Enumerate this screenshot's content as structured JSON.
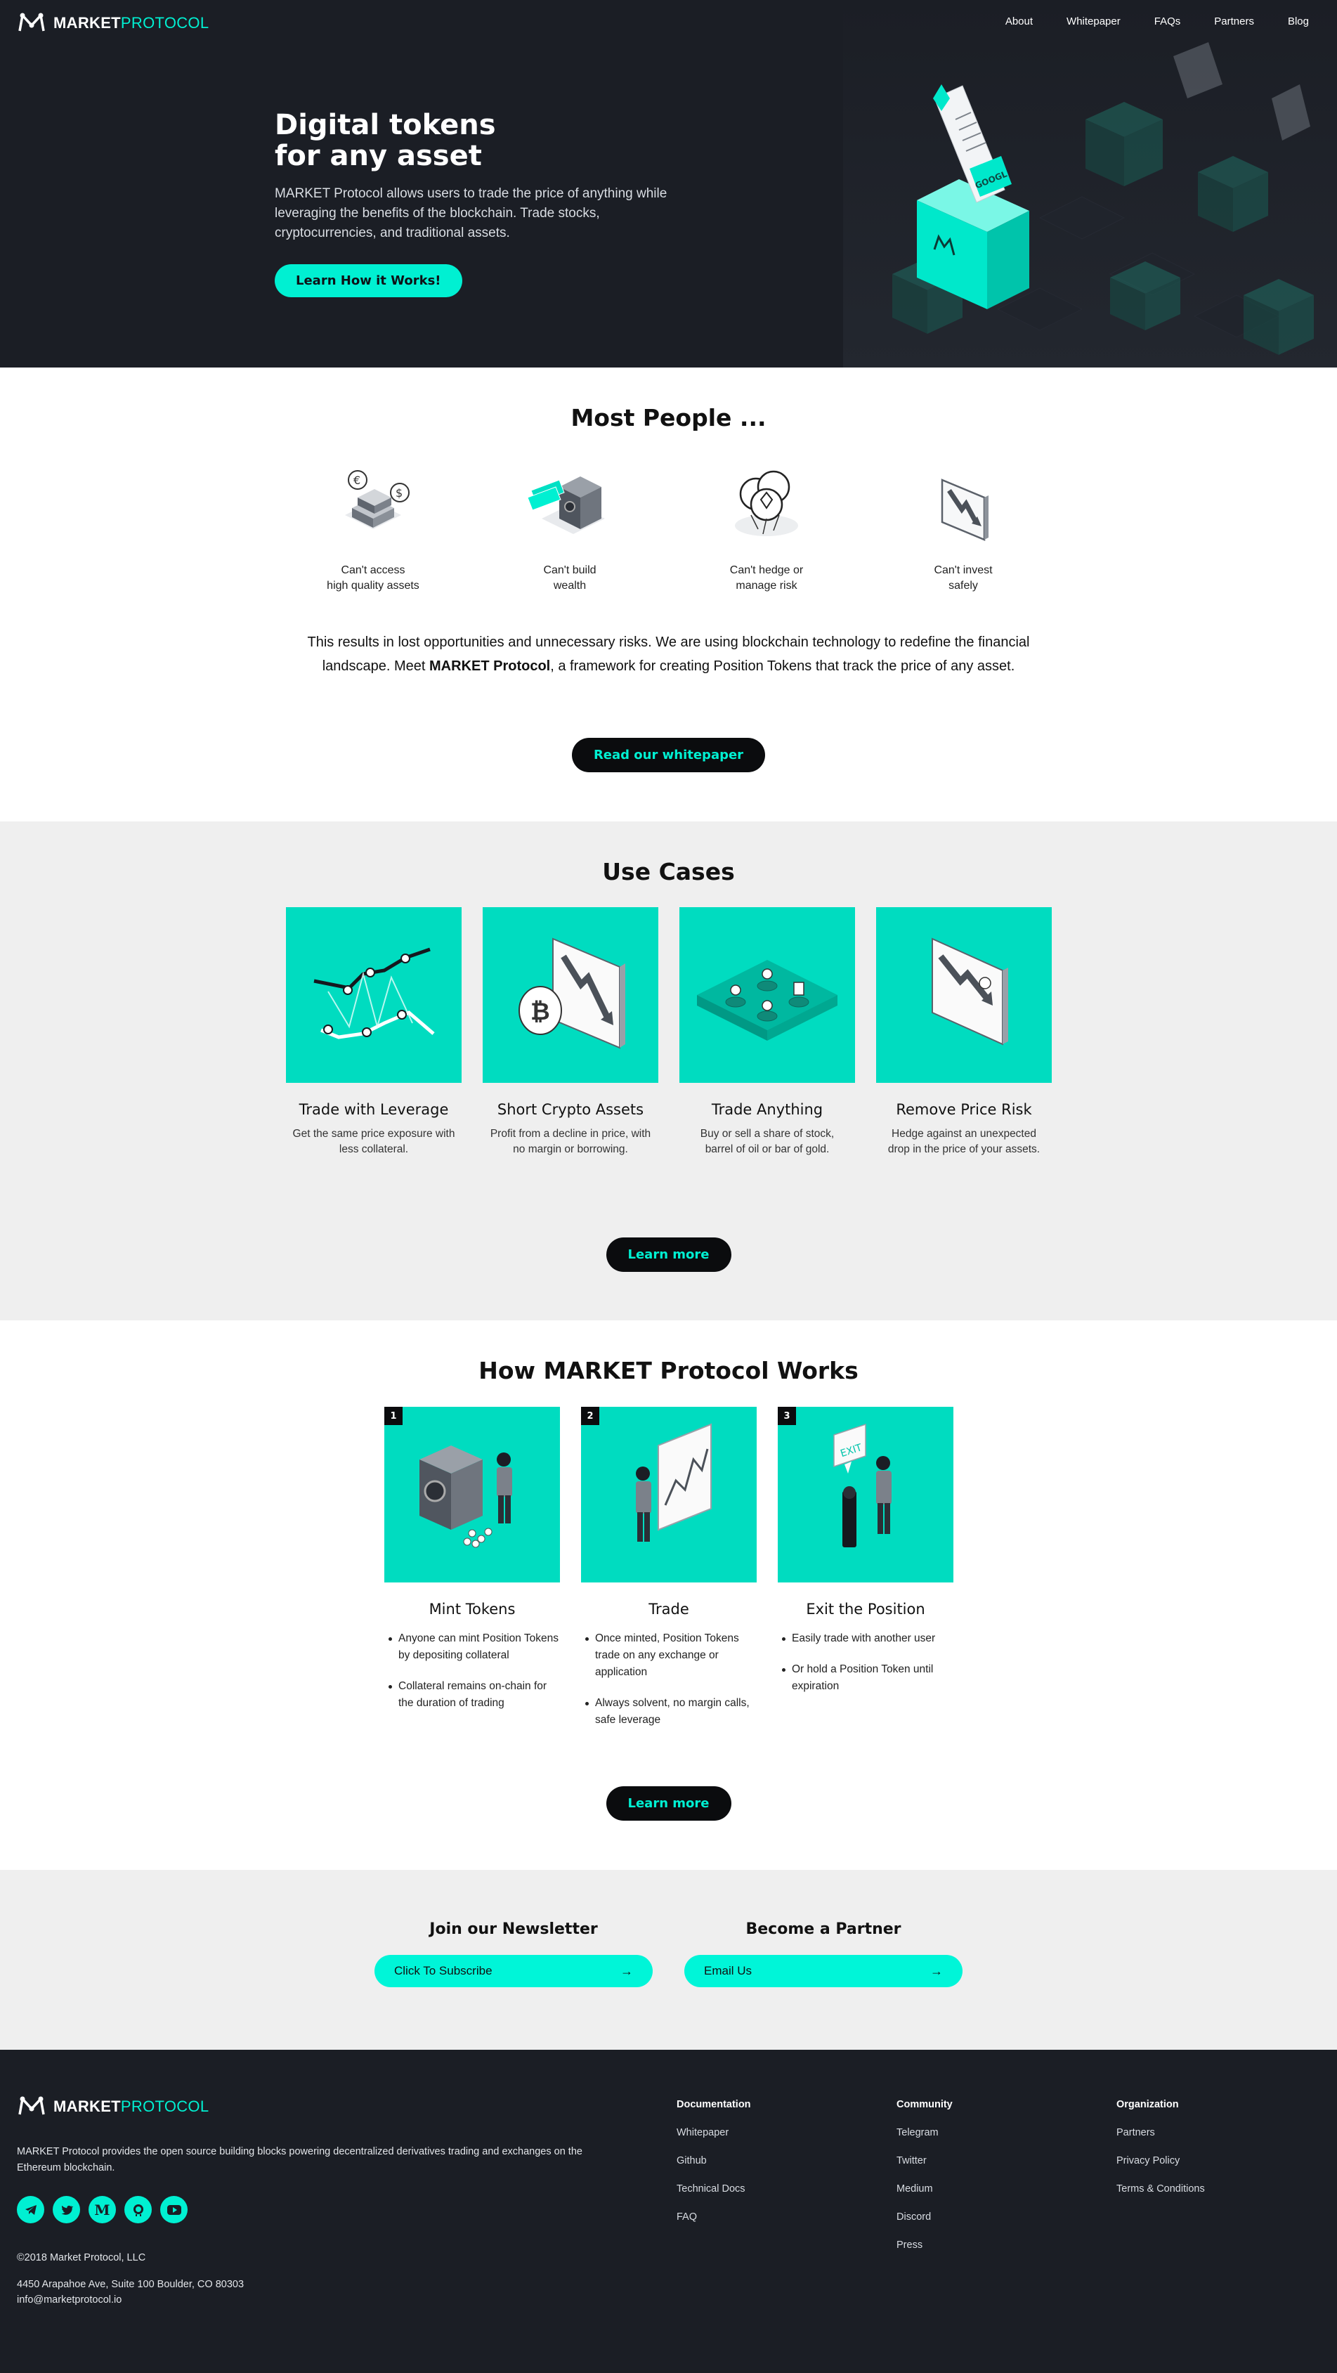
{
  "brand": {
    "name_main": "MARKET",
    "name_accent": "PROTOCOL"
  },
  "nav": {
    "items": [
      "About",
      "Whitepaper",
      "FAQs",
      "Partners",
      "Blog"
    ]
  },
  "hero": {
    "title_line1": "Digital tokens",
    "title_line2": "for any asset",
    "description": "MARKET Protocol allows users to trade the price of anything while leveraging the benefits of the blockchain. Trade stocks, cryptocurrencies, and traditional assets.",
    "cta": "Learn How it Works!",
    "token_label": "GOOGL"
  },
  "most_people": {
    "title": "Most People ...",
    "items": [
      {
        "line1": "Can't access",
        "line2": "high quality assets",
        "icon": "gold-bars-icon"
      },
      {
        "line1": "Can't build",
        "line2": "wealth",
        "icon": "safe-icon"
      },
      {
        "line1": "Can't hedge or",
        "line2": "manage risk",
        "icon": "coins-icon"
      },
      {
        "line1": "Can't invest",
        "line2": "safely",
        "icon": "falling-chart-icon"
      }
    ],
    "para_before": "This results in lost opportunities and unnecessary risks. We are using blockchain technology to redefine the financial landscape. Meet ",
    "para_bold": "MARKET Protocol",
    "para_after": ", a framework for creating Position Tokens that track the price of any asset.",
    "cta": "Read our whitepaper"
  },
  "use_cases": {
    "title": "Use Cases",
    "items": [
      {
        "title": "Trade with Leverage",
        "desc": "Get the same price exposure with less collateral."
      },
      {
        "title": "Short Crypto Assets",
        "desc": "Profit from a decline in price, with no margin or borrowing."
      },
      {
        "title": "Trade Anything",
        "desc": "Buy or sell a share of stock, barrel of oil or bar of gold."
      },
      {
        "title": "Remove Price Risk",
        "desc": "Hedge against an unexpected drop in the price of your assets."
      }
    ],
    "cta": "Learn more"
  },
  "how": {
    "title": "How MARKET Protocol Works",
    "steps": [
      {
        "num": "1",
        "title": "Mint Tokens",
        "bullets": [
          "Anyone can mint Position Tokens by depositing collateral",
          "Collateral remains on-chain for the duration of trading"
        ]
      },
      {
        "num": "2",
        "title": "Trade",
        "bullets": [
          "Once minted, Position Tokens trade on any exchange or application",
          "Always solvent, no margin calls, safe leverage"
        ]
      },
      {
        "num": "3",
        "title": "Exit the Position",
        "bullets": [
          "Easily trade with another user",
          "Or hold a Position Token until expiration"
        ],
        "sign": "EXIT"
      }
    ],
    "cta": "Learn more"
  },
  "cta_band": {
    "newsletter_title": "Join our Newsletter",
    "newsletter_btn": "Click To Subscribe",
    "partner_title": "Become a Partner",
    "partner_btn": "Email Us"
  },
  "footer": {
    "description": "MARKET Protocol provides the open source building blocks powering decentralized derivatives trading and exchanges on the Ethereum blockchain.",
    "social": [
      "telegram-icon",
      "twitter-icon",
      "medium-icon",
      "github-icon",
      "youtube-icon"
    ],
    "copyright": "©2018 Market Protocol, LLC",
    "address": "4450 Arapahoe Ave, Suite 100 Boulder, CO 80303",
    "email": "info@marketprotocol.io",
    "columns": [
      {
        "title": "Documentation",
        "links": [
          "Whitepaper",
          "Github",
          "Technical Docs",
          "FAQ"
        ]
      },
      {
        "title": "Community",
        "links": [
          "Telegram",
          "Twitter",
          "Medium",
          "Discord",
          "Press"
        ]
      },
      {
        "title": "Organization",
        "links": [
          "Partners",
          "Privacy Policy",
          "Terms & Conditions"
        ]
      }
    ]
  },
  "colors": {
    "accent": "#00f0d2",
    "dark": "#1b1e25",
    "card": "#00dcc0",
    "grey_band": "#efefef"
  }
}
